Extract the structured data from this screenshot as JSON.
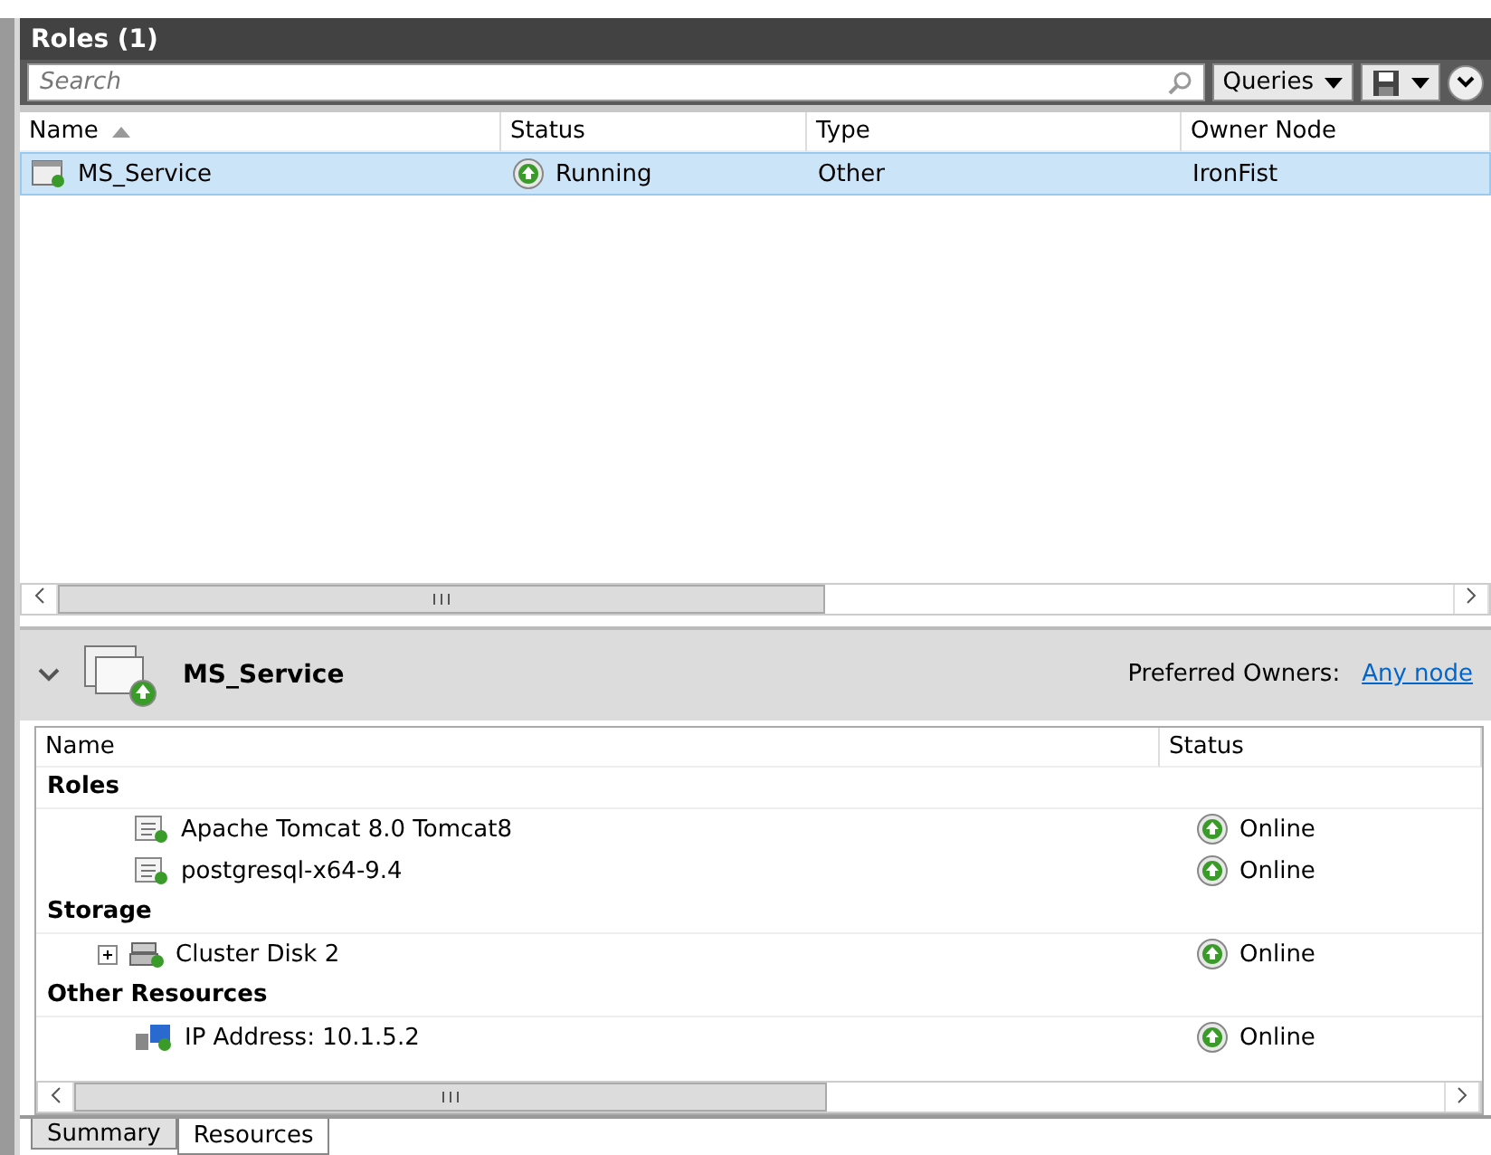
{
  "panel": {
    "title": "Roles (1)"
  },
  "search": {
    "placeholder": "Search"
  },
  "toolbar": {
    "queries": "Queries"
  },
  "roles_table": {
    "columns": [
      {
        "label": "Name",
        "sorted": true
      },
      {
        "label": "Status",
        "sorted": false
      },
      {
        "label": "Type",
        "sorted": false
      },
      {
        "label": "Owner Node",
        "sorted": false
      }
    ],
    "rows": [
      {
        "name": "MS_Service",
        "status": "Running",
        "type": "Other",
        "owner": "IronFist",
        "selected": true
      }
    ]
  },
  "detail": {
    "title": "MS_Service",
    "expanded": true,
    "owners_label": "Preferred Owners:",
    "owners_link": "Any node"
  },
  "resources_table": {
    "columns": [
      "Name",
      "Status"
    ],
    "groups": [
      {
        "label": "Roles",
        "children": [
          {
            "kind": "service",
            "name": "Apache Tomcat 8.0 Tomcat8",
            "status": "Online"
          },
          {
            "kind": "service",
            "name": "postgresql-x64-9.4",
            "status": "Online"
          }
        ]
      },
      {
        "label": "Storage",
        "children": [
          {
            "kind": "disk",
            "name": "Cluster Disk 2",
            "status": "Online",
            "expanded": false
          }
        ]
      },
      {
        "label": "Other Resources",
        "children": [
          {
            "kind": "network",
            "name": "IP Address: 10.1.5.2",
            "status": "Online"
          }
        ]
      }
    ]
  },
  "tabs": [
    {
      "label": "Summary",
      "selected": false
    },
    {
      "label": "Resources",
      "selected": true
    }
  ]
}
